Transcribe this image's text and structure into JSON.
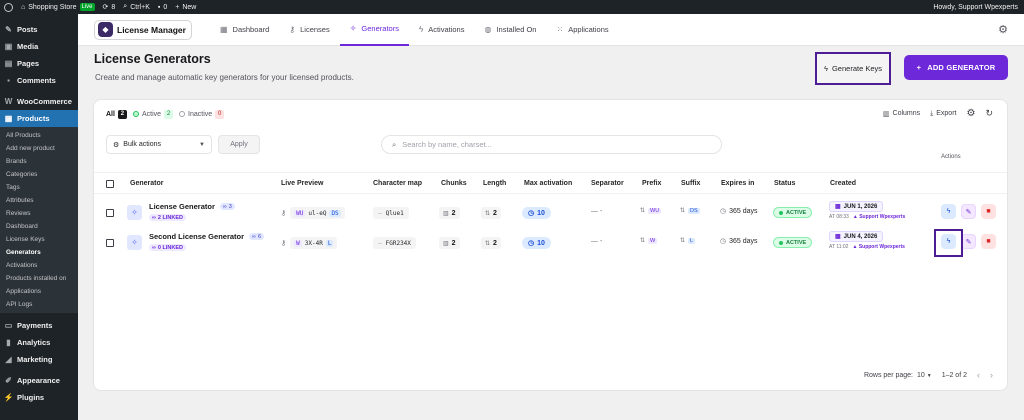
{
  "admin_bar": {
    "site_name": "Shopping Store",
    "live_badge": "Live",
    "updates_count": "8",
    "shortcut": "Ctrl+K",
    "comments_count": "0",
    "new_label": "New",
    "howdy": "Howdy, Support Wpexperts"
  },
  "sidebar": {
    "items_top": [
      {
        "label": "Posts",
        "icon": "pin-icon"
      },
      {
        "label": "Media",
        "icon": "media-icon"
      },
      {
        "label": "Pages",
        "icon": "page-icon"
      },
      {
        "label": "Comments",
        "icon": "comment-icon"
      }
    ],
    "woocommerce": "WooCommerce",
    "products": "Products",
    "submenu": [
      "All Products",
      "Add new product",
      "Brands",
      "Categories",
      "Tags",
      "Attributes",
      "Reviews",
      "Dashboard",
      "License Keys",
      "Generators",
      "Activations",
      "Products installed on",
      "Applications",
      "API Logs"
    ],
    "current_sub": "Generators",
    "items_bottom": [
      {
        "label": "Payments"
      },
      {
        "label": "Analytics"
      },
      {
        "label": "Marketing"
      },
      {
        "label": "Appearance"
      },
      {
        "label": "Plugins"
      }
    ]
  },
  "topnav": {
    "logo_text": "License Manager",
    "tabs": [
      {
        "label": "Dashboard",
        "icon": "grid-icon"
      },
      {
        "label": "Licenses",
        "icon": "key-icon"
      },
      {
        "label": "Generators",
        "icon": "sparkle-icon"
      },
      {
        "label": "Activations",
        "icon": "bolt-icon"
      },
      {
        "label": "Installed On",
        "icon": "globe-icon"
      },
      {
        "label": "Applications",
        "icon": "apps-icon"
      }
    ],
    "active_tab": "Generators"
  },
  "header": {
    "title": "License Generators",
    "subtitle": "Create and manage automatic key generators for your licensed products.",
    "generate_keys": "Generate Keys",
    "add_generator": "ADD GENERATOR"
  },
  "filters": {
    "all_label": "All",
    "all_count": "2",
    "active_label": "Active",
    "active_count": "2",
    "inactive_label": "Inactive",
    "inactive_count": "0"
  },
  "toolbar": {
    "columns": "Columns",
    "export": "Export"
  },
  "bulk": {
    "label": "Bulk actions",
    "apply": "Apply"
  },
  "search": {
    "placeholder": "Search by name, charset..."
  },
  "table": {
    "actions_header": "Actions",
    "headers": [
      "Generator",
      "Live Preview",
      "Character map",
      "Chunks",
      "Length",
      "Max activation",
      "Separator",
      "Prefix",
      "Suffix",
      "Expires in",
      "Status",
      "Created"
    ],
    "rows": [
      {
        "name": "License Generator",
        "linked_tag": "3",
        "linked": "2 LINKED",
        "preview_prefix": "WU",
        "preview_key": "ul-eQ",
        "preview_suffix": "DS",
        "charmap": "Qlue1",
        "chunks": "2",
        "length": "2",
        "max_activation": "10",
        "separator": "-",
        "prefix": "WU",
        "suffix": "DS",
        "expires": "365 days",
        "status": "ACTIVE",
        "created_date": "JUN 1, 2026",
        "created_time": "AT 08:33",
        "created_by": "Support Wpexperts"
      },
      {
        "name": "Second License Generator",
        "linked_tag": "6",
        "linked": "0 LINKED",
        "preview_prefix": "W",
        "preview_key": "3X-4R",
        "preview_suffix": "L",
        "charmap": "FGR234X",
        "chunks": "2",
        "length": "2",
        "max_activation": "10",
        "separator": "-",
        "prefix": "W",
        "suffix": "L",
        "expires": "365 days",
        "status": "ACTIVE",
        "created_date": "JUN 4, 2026",
        "created_time": "AT 11:02",
        "created_by": "Support Wpexperts"
      }
    ]
  },
  "footer": {
    "rows_per_page_label": "Rows per page:",
    "rows_per_page": "10",
    "range": "1–2 of 2"
  }
}
